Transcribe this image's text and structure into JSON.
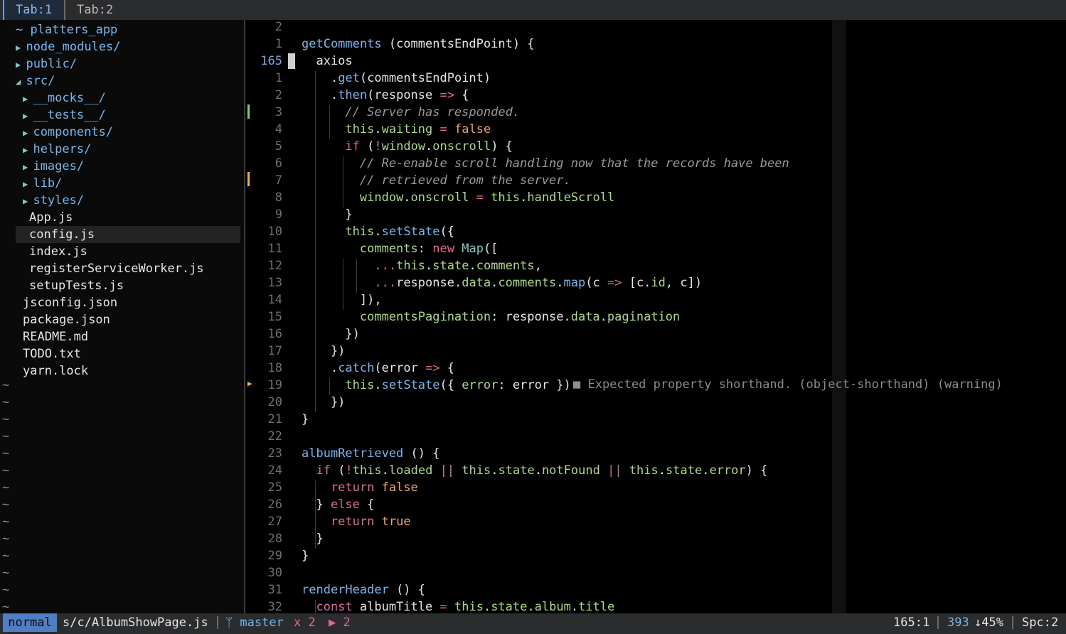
{
  "tabs": [
    {
      "label": "Tab:1",
      "active": true
    },
    {
      "label": "Tab:2",
      "active": false
    }
  ],
  "tree": {
    "root": "~ platters_app",
    "items": [
      {
        "label": "node_modules/",
        "type": "dir",
        "depth": 1,
        "open": false
      },
      {
        "label": "public/",
        "type": "dir",
        "depth": 1,
        "open": false
      },
      {
        "label": "src/",
        "type": "dir",
        "depth": 1,
        "open": true
      },
      {
        "label": "__mocks__/",
        "type": "dir",
        "depth": 2,
        "open": false
      },
      {
        "label": "__tests__/",
        "type": "dir",
        "depth": 2,
        "open": false
      },
      {
        "label": "components/",
        "type": "dir",
        "depth": 2,
        "open": false
      },
      {
        "label": "helpers/",
        "type": "dir",
        "depth": 2,
        "open": false
      },
      {
        "label": "images/",
        "type": "dir",
        "depth": 2,
        "open": false
      },
      {
        "label": "lib/",
        "type": "dir",
        "depth": 2,
        "open": false
      },
      {
        "label": "styles/",
        "type": "dir",
        "depth": 2,
        "open": false
      },
      {
        "label": "App.js",
        "type": "file",
        "depth": 2,
        "selected": true
      },
      {
        "label": "config.js",
        "type": "file",
        "depth": 2
      },
      {
        "label": "index.js",
        "type": "file",
        "depth": 2
      },
      {
        "label": "registerServiceWorker.js",
        "type": "file",
        "depth": 2
      },
      {
        "label": "setupTests.js",
        "type": "file",
        "depth": 2
      },
      {
        "label": "jsconfig.json",
        "type": "file",
        "depth": 1
      },
      {
        "label": "package.json",
        "type": "file",
        "depth": 1
      },
      {
        "label": "README.md",
        "type": "file",
        "depth": 1
      },
      {
        "label": "TODO.txt",
        "type": "file",
        "depth": 1
      },
      {
        "label": "yarn.lock",
        "type": "file",
        "depth": 1
      }
    ],
    "tilde": "~"
  },
  "editor": {
    "line_numbers": [
      "2",
      "1",
      "165",
      "1",
      "2",
      "3",
      "4",
      "5",
      "6",
      "7",
      "8",
      "9",
      "10",
      "11",
      "12",
      "13",
      "14",
      "15",
      "16",
      "17",
      "18",
      "19",
      "20",
      "21",
      "22",
      "23",
      "24",
      "25",
      "26",
      "27",
      "28",
      "29",
      "30",
      "31",
      "32"
    ],
    "current_line": "165",
    "diagnostic": "■ Expected property shorthand. (object-shorthand) (warning)",
    "warning_sign": "▶",
    "lines": [
      [],
      [
        [
          "fn",
          "getComments"
        ],
        [
          "pl",
          " (commentsEndPoint) {"
        ]
      ],
      [
        [
          "pl",
          "  axios"
        ]
      ],
      [
        [
          "pl",
          "    ."
        ],
        [
          "fn",
          "get"
        ],
        [
          "pl",
          "(commentsEndPoint)"
        ]
      ],
      [
        [
          "pl",
          "    ."
        ],
        [
          "fn",
          "then"
        ],
        [
          "pl",
          "(response "
        ],
        [
          "op",
          "=>"
        ],
        [
          "pl",
          " {"
        ]
      ],
      [
        [
          "cm",
          "      // Server has responded."
        ]
      ],
      [
        [
          "gr",
          "      this"
        ],
        [
          "pl",
          "."
        ],
        [
          "gr",
          "waiting"
        ],
        [
          "pl",
          " "
        ],
        [
          "op",
          "="
        ],
        [
          "pl",
          " "
        ],
        [
          "bool",
          "false"
        ]
      ],
      [
        [
          "kw",
          "      if"
        ],
        [
          "pl",
          " ("
        ],
        [
          "op",
          "!"
        ],
        [
          "gr",
          "window"
        ],
        [
          "pl",
          "."
        ],
        [
          "gr",
          "onscroll"
        ],
        [
          "pl",
          ") {"
        ]
      ],
      [
        [
          "cm",
          "        // Re-enable scroll handling now that the records have been"
        ]
      ],
      [
        [
          "cm",
          "        // retrieved from the server."
        ]
      ],
      [
        [
          "gr",
          "        window"
        ],
        [
          "pl",
          "."
        ],
        [
          "gr",
          "onscroll"
        ],
        [
          "pl",
          " "
        ],
        [
          "op",
          "="
        ],
        [
          "pl",
          " "
        ],
        [
          "gr",
          "this"
        ],
        [
          "pl",
          "."
        ],
        [
          "gr",
          "handleScroll"
        ]
      ],
      [
        [
          "pl",
          "      }"
        ]
      ],
      [
        [
          "gr",
          "      this"
        ],
        [
          "pl",
          "."
        ],
        [
          "fn",
          "setState"
        ],
        [
          "pl",
          "({"
        ]
      ],
      [
        [
          "gr",
          "        comments"
        ],
        [
          "pl",
          ": "
        ],
        [
          "kw",
          "new"
        ],
        [
          "pl",
          " "
        ],
        [
          "ty",
          "Map"
        ],
        [
          "pl",
          "(["
        ]
      ],
      [
        [
          "pl",
          "          "
        ],
        [
          "op",
          "..."
        ],
        [
          "gr",
          "this"
        ],
        [
          "pl",
          "."
        ],
        [
          "gr",
          "state"
        ],
        [
          "pl",
          "."
        ],
        [
          "gr",
          "comments"
        ],
        [
          "pl",
          ","
        ]
      ],
      [
        [
          "pl",
          "          "
        ],
        [
          "op",
          "..."
        ],
        [
          "pl",
          "response."
        ],
        [
          "gr",
          "data"
        ],
        [
          "pl",
          "."
        ],
        [
          "gr",
          "comments"
        ],
        [
          "pl",
          "."
        ],
        [
          "fn",
          "map"
        ],
        [
          "pl",
          "(c "
        ],
        [
          "op",
          "=>"
        ],
        [
          "pl",
          " [c."
        ],
        [
          "gr",
          "id"
        ],
        [
          "pl",
          ", c])"
        ]
      ],
      [
        [
          "pl",
          "        ]),"
        ]
      ],
      [
        [
          "gr",
          "        commentsPagination"
        ],
        [
          "pl",
          ": response."
        ],
        [
          "gr",
          "data"
        ],
        [
          "pl",
          "."
        ],
        [
          "gr",
          "pagination"
        ]
      ],
      [
        [
          "pl",
          "      })"
        ]
      ],
      [
        [
          "pl",
          "    })"
        ]
      ],
      [
        [
          "pl",
          "    ."
        ],
        [
          "fn",
          "catch"
        ],
        [
          "pl",
          "(error "
        ],
        [
          "op",
          "=>"
        ],
        [
          "pl",
          " {"
        ]
      ],
      [
        [
          "gr",
          "      this"
        ],
        [
          "pl",
          "."
        ],
        [
          "fn",
          "setState"
        ],
        [
          "pl",
          "({ "
        ],
        [
          "gr",
          "error"
        ],
        [
          "pl",
          ": error })"
        ]
      ],
      [
        [
          "pl",
          "    })"
        ]
      ],
      [
        [
          "pl",
          "}"
        ]
      ],
      [],
      [
        [
          "fn",
          "albumRetrieved"
        ],
        [
          "pl",
          " () {"
        ]
      ],
      [
        [
          "kw",
          "  if"
        ],
        [
          "pl",
          " ("
        ],
        [
          "op",
          "!"
        ],
        [
          "gr",
          "this"
        ],
        [
          "pl",
          "."
        ],
        [
          "gr",
          "loaded"
        ],
        [
          "pl",
          " "
        ],
        [
          "op",
          "||"
        ],
        [
          "pl",
          " "
        ],
        [
          "gr",
          "this"
        ],
        [
          "pl",
          "."
        ],
        [
          "gr",
          "state"
        ],
        [
          "pl",
          "."
        ],
        [
          "gr",
          "notFound"
        ],
        [
          "pl",
          " "
        ],
        [
          "op",
          "||"
        ],
        [
          "pl",
          " "
        ],
        [
          "gr",
          "this"
        ],
        [
          "pl",
          "."
        ],
        [
          "gr",
          "state"
        ],
        [
          "pl",
          "."
        ],
        [
          "gr",
          "error"
        ],
        [
          "pl",
          ") {"
        ]
      ],
      [
        [
          "kw",
          "    return"
        ],
        [
          "pl",
          " "
        ],
        [
          "bool",
          "false"
        ]
      ],
      [
        [
          "pl",
          "  } "
        ],
        [
          "kw",
          "else"
        ],
        [
          "pl",
          " {"
        ]
      ],
      [
        [
          "kw",
          "    return"
        ],
        [
          "pl",
          " "
        ],
        [
          "bool",
          "true"
        ]
      ],
      [
        [
          "pl",
          "  }"
        ]
      ],
      [
        [
          "pl",
          "}"
        ]
      ],
      [],
      [
        [
          "fn",
          "renderHeader"
        ],
        [
          "pl",
          " () {"
        ]
      ],
      [
        [
          "kw",
          "  const"
        ],
        [
          "pl",
          " albumTitle "
        ],
        [
          "op",
          "="
        ],
        [
          "pl",
          " "
        ],
        [
          "gr",
          "this"
        ],
        [
          "pl",
          "."
        ],
        [
          "gr",
          "state"
        ],
        [
          "pl",
          "."
        ],
        [
          "gr",
          "album"
        ],
        [
          "pl",
          "."
        ],
        [
          "gr",
          "title"
        ]
      ]
    ]
  },
  "status": {
    "mode": "normal",
    "file": "s/c/AlbumShowPage.js",
    "branch": "ᛘ master",
    "errors": "x 2",
    "warnings": "▶ 2",
    "position": "165:1",
    "total_lines": "393",
    "percent": "↓45%",
    "indent": "Spc:2"
  },
  "colors": {
    "accent": "#4f7ec4",
    "keyword": "#e4669b",
    "property": "#a8dc7f",
    "function": "#72b7ef",
    "literal": "#f0a35e"
  }
}
